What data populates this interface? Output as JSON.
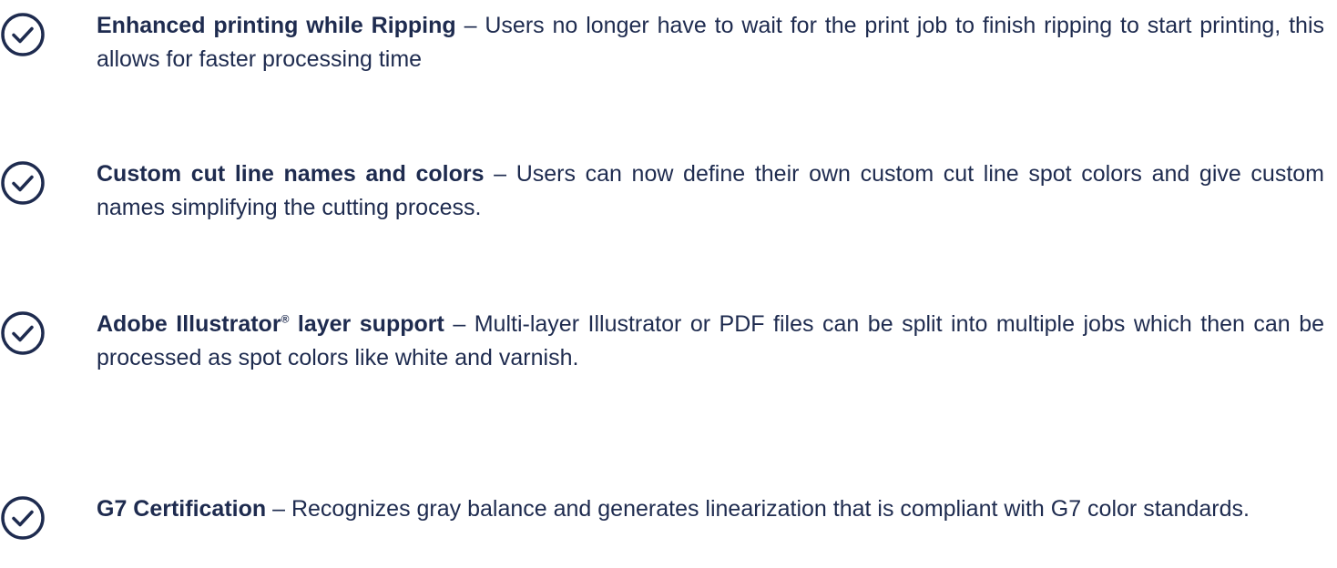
{
  "accent_color": "#1e2b4f",
  "icon": "check-circle-icon",
  "features": [
    {
      "title": "Enhanced printing while Ripping",
      "title_sup": "",
      "title_after": "",
      "separator": " – ",
      "description": "Users no longer have to wait for the print job to finish ripping to start printing, this allows for faster processing time"
    },
    {
      "title": "Custom cut line names and colors",
      "title_sup": "",
      "title_after": "",
      "separator": " – ",
      "description": "Users can now define their own custom cut line spot colors and give custom names simplifying the cutting process."
    },
    {
      "title": "Adobe Illustrator",
      "title_sup": "®",
      "title_after": " layer support",
      "separator": " – ",
      "description": "Multi-layer Illustrator or PDF files can be split into multiple jobs which then can be processed as spot colors like white and varnish."
    },
    {
      "title": "G7 Certification",
      "title_sup": "",
      "title_after": "",
      "separator": " – ",
      "description": "Recognizes gray balance and generates linearization that is compliant with G7 color standards."
    }
  ]
}
